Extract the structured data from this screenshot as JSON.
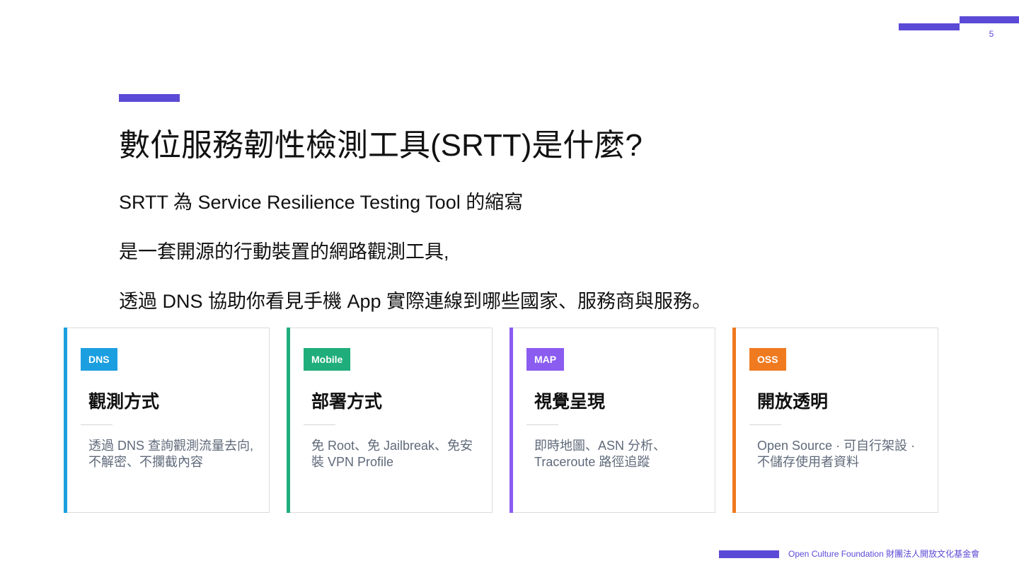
{
  "page_number": "5",
  "title": "數位服務韌性檢測工具(SRTT)是什麼?",
  "lines": [
    "SRTT 為 Service Resilience Testing Tool 的縮寫",
    "是一套開源的行動裝置的網路觀測工具,",
    "透過 DNS 協助你看見手機 App 實際連線到哪些國家、服務商與服務。"
  ],
  "cards": [
    {
      "badge": "DNS",
      "color": "#1b9fe0",
      "title": "觀測方式",
      "description": "透過 DNS 查詢觀測流量去向,不解密、不攔截內容"
    },
    {
      "badge": "Mobile",
      "color": "#1fae7b",
      "title": "部署方式",
      "description": "免 Root、免 Jailbreak、免安裝 VPN Profile"
    },
    {
      "badge": "MAP",
      "color": "#8b5cf0",
      "title": "視覺呈現",
      "description": "即時地圖、ASN 分析、Traceroute 路徑追蹤"
    },
    {
      "badge": "OSS",
      "color": "#f07a1f",
      "title": "開放透明",
      "description": "Open Source · 可自行架設 · 不儲存使用者資料"
    }
  ],
  "footer": {
    "text": "Open Culture Foundation 財團法人開放文化基金會"
  },
  "accent_color": "#5b4ad6"
}
